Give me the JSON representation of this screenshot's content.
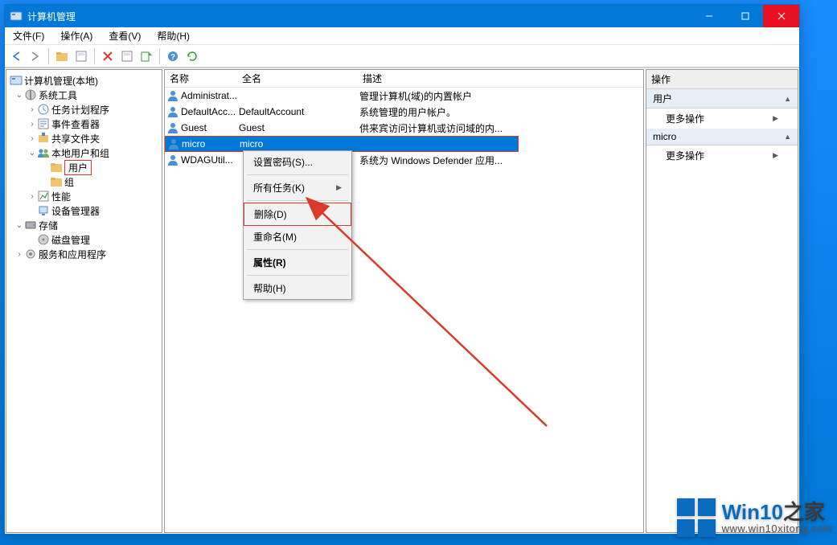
{
  "title": "计算机管理",
  "menu": {
    "file": "文件(F)",
    "action": "操作(A)",
    "view": "查看(V)",
    "help": "帮助(H)"
  },
  "tree": {
    "root": "计算机管理(本地)",
    "system_tools": "系统工具",
    "task_scheduler": "任务计划程序",
    "event_viewer": "事件查看器",
    "shared_folders": "共享文件夹",
    "local_users": "本地用户和组",
    "users": "用户",
    "groups": "组",
    "performance": "性能",
    "device_manager": "设备管理器",
    "storage": "存储",
    "disk_management": "磁盘管理",
    "services_apps": "服务和应用程序"
  },
  "columns": {
    "name": "名称",
    "fullname": "全名",
    "desc": "描述"
  },
  "rows": [
    {
      "name": "Administrat...",
      "full": "",
      "desc": "管理计算机(域)的内置帐户"
    },
    {
      "name": "DefaultAcc...",
      "full": "DefaultAccount",
      "desc": "系统管理的用户帐户。"
    },
    {
      "name": "Guest",
      "full": "Guest",
      "desc": "供来宾访问计算机或访问域的内..."
    },
    {
      "name": "micro",
      "full": "micro",
      "desc": ""
    },
    {
      "name": "WDAGUtil...",
      "full": "",
      "desc": "系统为 Windows Defender 应用..."
    }
  ],
  "context_menu": {
    "set_password": "设置密码(S)...",
    "all_tasks": "所有任务(K)",
    "delete": "删除(D)",
    "rename": "重命名(M)",
    "properties": "属性(R)",
    "help": "帮助(H)"
  },
  "actions": {
    "header": "操作",
    "group1": "用户",
    "more1": "更多操作",
    "group2": "micro",
    "more2": "更多操作"
  },
  "watermark": {
    "brand_prefix": "Win10",
    "brand_suffix": "之家",
    "url": "www.win10xitong.com"
  }
}
